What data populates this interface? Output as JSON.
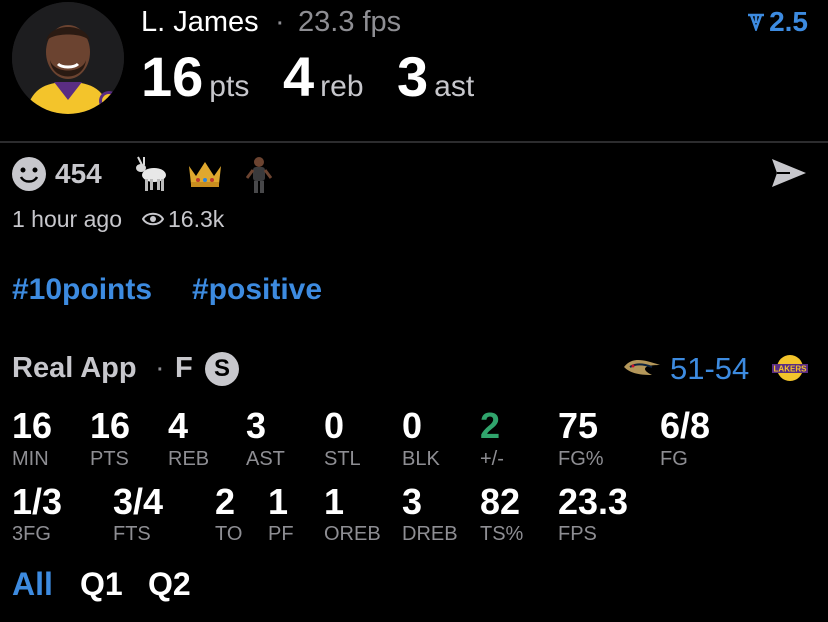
{
  "player": {
    "name": "L. James",
    "separator": "·",
    "fps": "23.3 fps",
    "boost": "2.5"
  },
  "headline": {
    "pts_value": "16",
    "pts_label": "pts",
    "reb_value": "4",
    "reb_label": "reb",
    "ast_value": "3",
    "ast_label": "ast"
  },
  "reactions": {
    "count": "454",
    "icons": [
      "goat-icon",
      "crown-icon",
      "celebrating-player-icon"
    ]
  },
  "meta": {
    "time_ago": "1 hour ago",
    "views": "16.3k"
  },
  "tags": [
    "#10points",
    "#positive"
  ],
  "game": {
    "app": "Real App",
    "separator": "·",
    "position": "F",
    "badge": "S",
    "score": "51-54"
  },
  "stats_row1": [
    {
      "value": "16",
      "label": "MIN"
    },
    {
      "value": "16",
      "label": "PTS"
    },
    {
      "value": "4",
      "label": "REB"
    },
    {
      "value": "3",
      "label": "AST"
    },
    {
      "value": "0",
      "label": "STL"
    },
    {
      "value": "0",
      "label": "BLK"
    },
    {
      "value": "2",
      "label": "+/-"
    },
    {
      "value": "75",
      "label": "FG%"
    },
    {
      "value": "6/8",
      "label": "FG"
    }
  ],
  "stats_row2": [
    {
      "value": "1/3",
      "label": "3FG"
    },
    {
      "value": "3/4",
      "label": "FTS"
    },
    {
      "value": "2",
      "label": "TO"
    },
    {
      "value": "1",
      "label": "PF"
    },
    {
      "value": "1",
      "label": "OREB"
    },
    {
      "value": "3",
      "label": "DREB"
    },
    {
      "value": "82",
      "label": "TS%"
    },
    {
      "value": "23.3",
      "label": "FPS"
    }
  ],
  "quarters": [
    "All",
    "Q1",
    "Q2"
  ],
  "colors": {
    "accent": "#3d8be0",
    "positive": "#30a46c"
  }
}
